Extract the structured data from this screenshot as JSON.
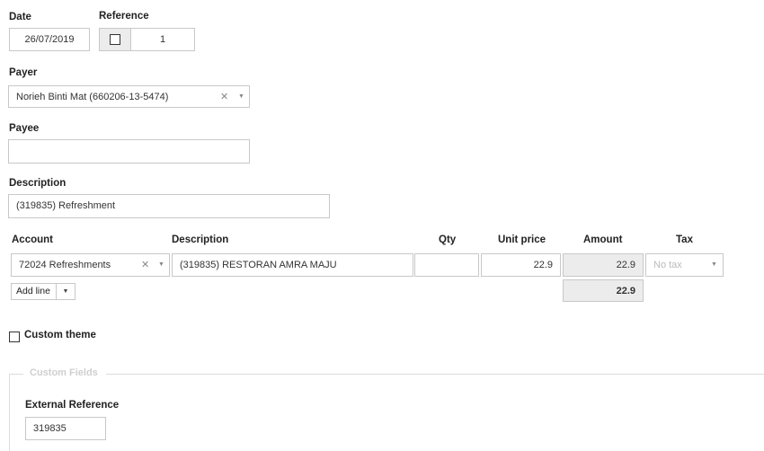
{
  "date": {
    "label": "Date",
    "value": "26/07/2019"
  },
  "reference": {
    "label": "Reference",
    "value": "1"
  },
  "payer": {
    "label": "Payer",
    "value": "Norieh Binti Mat (660206-13-5474)"
  },
  "payee": {
    "label": "Payee",
    "value": ""
  },
  "description": {
    "label": "Description",
    "value": "(319835) Refreshment"
  },
  "lines": {
    "headers": {
      "account": "Account",
      "description": "Description",
      "qty": "Qty",
      "unit_price": "Unit price",
      "amount": "Amount",
      "tax": "Tax"
    },
    "rows": [
      {
        "account": "72024 Refreshments",
        "description": "(319835) RESTORAN AMRA MAJU",
        "qty": "",
        "unit_price": "22.9",
        "amount": "22.9",
        "tax_placeholder": "No tax"
      }
    ],
    "total": "22.9",
    "add_line_label": "Add line"
  },
  "custom_theme": {
    "label": "Custom theme"
  },
  "custom_fields": {
    "legend": "Custom Fields",
    "external_reference": {
      "label": "External Reference",
      "value": "319835"
    }
  },
  "icons": {
    "clear": "clear-icon",
    "dropdown": "chevron-down-icon"
  }
}
